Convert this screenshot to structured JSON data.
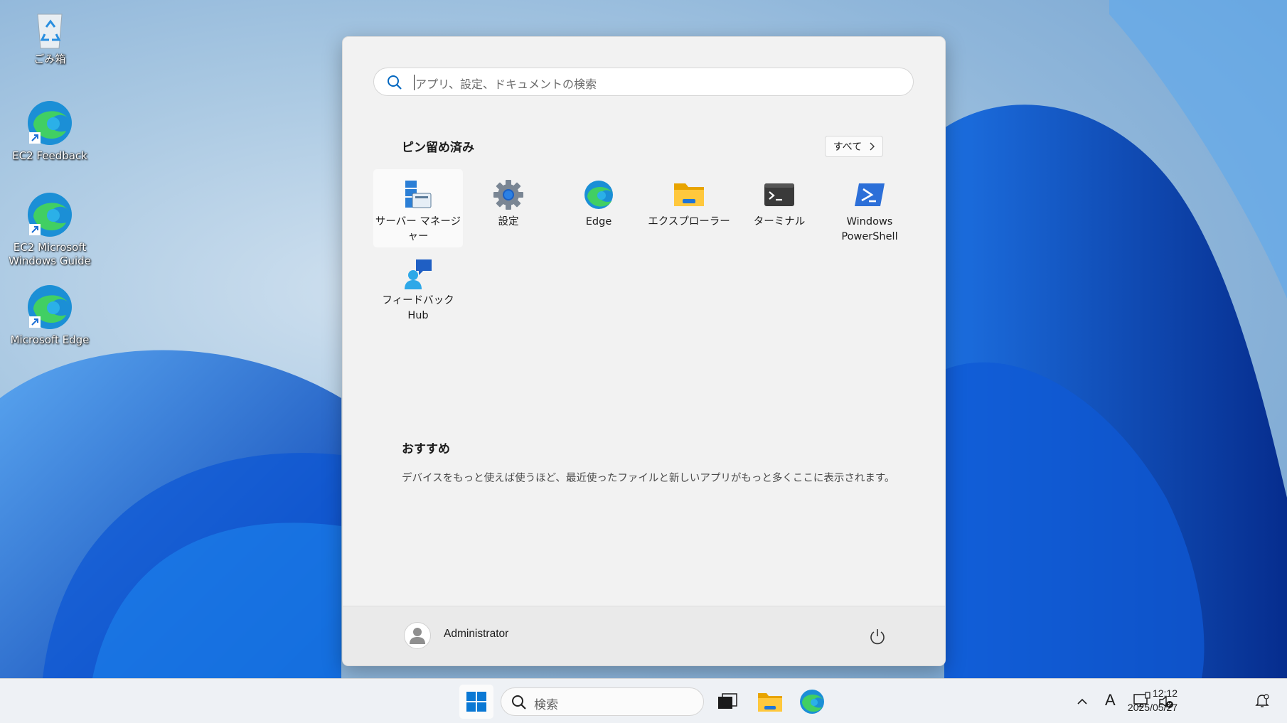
{
  "desktop": {
    "icons": [
      {
        "label": "ごみ箱",
        "icon": "recycle-bin-icon"
      },
      {
        "label": "EC2 Feedback",
        "icon": "edge-shortcut-icon"
      },
      {
        "label": "EC2 Microsoft Windows Guide",
        "icon": "edge-shortcut-icon"
      },
      {
        "label": "Microsoft Edge",
        "icon": "edge-shortcut-icon"
      }
    ]
  },
  "start_menu": {
    "search": {
      "placeholder": "アプリ、設定、ドキュメントの検索",
      "icon": "search-icon"
    },
    "pinned": {
      "title": "ピン留め済み",
      "all_button": "すべて",
      "apps": [
        {
          "label": "サーバー マネージャー",
          "icon": "server-manager-icon"
        },
        {
          "label": "設定",
          "icon": "settings-gear-icon"
        },
        {
          "label": "Edge",
          "icon": "edge-icon"
        },
        {
          "label": "エクスプローラー",
          "icon": "folder-icon"
        },
        {
          "label": "ターミナル",
          "icon": "terminal-icon"
        },
        {
          "label": "Windows PowerShell",
          "icon": "powershell-icon"
        },
        {
          "label": "フィードバック Hub",
          "icon": "feedback-hub-icon"
        }
      ]
    },
    "recommended": {
      "title": "おすすめ",
      "message": "デバイスをもっと使えば使うほど、最近使ったファイルと新しいアプリがもっと多くここに表示されます。"
    },
    "footer": {
      "user_name": "Administrator",
      "power_icon": "power-icon"
    }
  },
  "taskbar": {
    "search_label": "検索",
    "apps": [
      "start-icon",
      "task-view-icon",
      "file-explorer-icon",
      "edge-icon"
    ],
    "tray": {
      "ime_label": "A",
      "time": "12:12",
      "date": "2025/05/27"
    }
  },
  "colors": {
    "accent": "#0067c0",
    "menu_bg": "#f2f2f2",
    "taskbar_bg": "#eef1f5"
  }
}
